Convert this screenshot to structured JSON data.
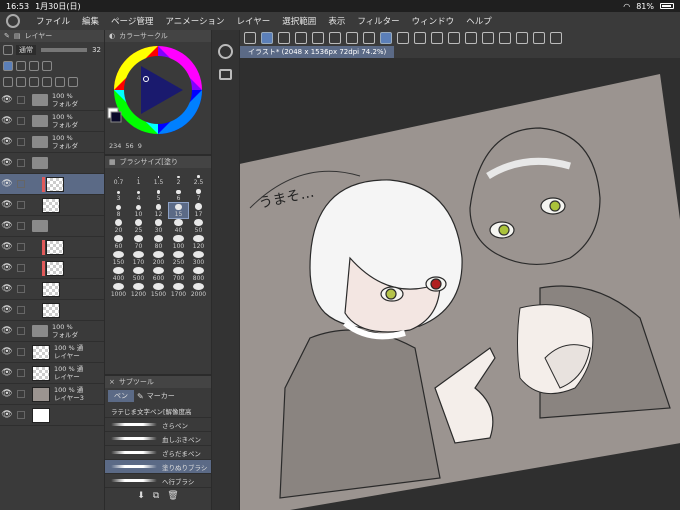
{
  "status": {
    "time": "16:53",
    "date": "1月30日(日)",
    "battery": "81%"
  },
  "menu": [
    "ファイル",
    "編集",
    "ページ管理",
    "アニメーション",
    "レイヤー",
    "選択範囲",
    "表示",
    "フィルター",
    "ウィンドウ",
    "ヘルプ"
  ],
  "layer_panel": {
    "header": "レイヤー",
    "blend_mode": "通常",
    "opacity_value": "32",
    "layers": [
      {
        "kind": "folder",
        "line1": "100 %",
        "line2": "フォルダ",
        "selected": false,
        "red": false
      },
      {
        "kind": "folder",
        "line1": "100 %",
        "line2": "フォルダ",
        "selected": false,
        "red": false
      },
      {
        "kind": "folder-open",
        "line1": "100 %",
        "line2": "フォルダ",
        "selected": false,
        "red": false
      },
      {
        "kind": "folder-open",
        "line1": "",
        "line2": "",
        "selected": false,
        "red": false
      },
      {
        "kind": "thumb",
        "line1": "",
        "line2": "",
        "selected": true,
        "red": true
      },
      {
        "kind": "thumb",
        "line1": "",
        "line2": "",
        "selected": false,
        "red": false
      },
      {
        "kind": "folder-open",
        "line1": "",
        "line2": "",
        "selected": false,
        "red": false
      },
      {
        "kind": "thumb",
        "line1": "",
        "line2": "",
        "selected": false,
        "red": true
      },
      {
        "kind": "thumb",
        "line1": "",
        "line2": "",
        "selected": false,
        "red": true
      },
      {
        "kind": "thumb",
        "line1": "",
        "line2": "",
        "selected": false,
        "red": false
      },
      {
        "kind": "thumb",
        "line1": "",
        "line2": "",
        "selected": false,
        "red": false
      },
      {
        "kind": "folder",
        "line1": "100 %",
        "line2": "フォルダ",
        "selected": false,
        "red": false
      },
      {
        "kind": "thumb",
        "line1": "100 % 通",
        "line2": "レイヤー",
        "selected": false,
        "red": false
      },
      {
        "kind": "thumb",
        "line1": "100 % 通",
        "line2": "レイヤー",
        "selected": false,
        "red": false
      },
      {
        "kind": "gray",
        "line1": "100 % 通",
        "line2": "レイヤー3",
        "selected": false,
        "red": false
      },
      {
        "kind": "white",
        "line1": "",
        "line2": "",
        "selected": false,
        "red": false
      }
    ]
  },
  "color_panel": {
    "header": "カラーサークル",
    "h_value": "234",
    "s_value": "56",
    "v_value": "9"
  },
  "brush_size_panel": {
    "header": "ブラシサイズ[塗り",
    "sizes": [
      "0.7",
      "1",
      "1.5",
      "2",
      "2.5",
      "3",
      "4",
      "5",
      "6",
      "7",
      "8",
      "10",
      "12",
      "15",
      "17",
      "20",
      "25",
      "30",
      "40",
      "50",
      "60",
      "70",
      "80",
      "100",
      "120",
      "150",
      "170",
      "200",
      "250",
      "300",
      "400",
      "500",
      "600",
      "700",
      "800",
      "1000",
      "1200",
      "1500",
      "1700",
      "2000"
    ],
    "selected": "15"
  },
  "subtool_panel": {
    "header": "サブツール",
    "group_pen": "ペン",
    "group_marker": "マーカー",
    "brushes": [
      "ラテじま文字ペン[解像度高",
      "さらペン",
      "血しぶきペン",
      "ざらだまペン",
      "塗りぬりブラシ",
      "ヘ行ブラシ"
    ],
    "selected_index": 4
  },
  "canvas": {
    "tab_label": "イラスト* (2048 x 1536px 72dpi 74.2%)",
    "handwritten_text": "うまそ…"
  }
}
